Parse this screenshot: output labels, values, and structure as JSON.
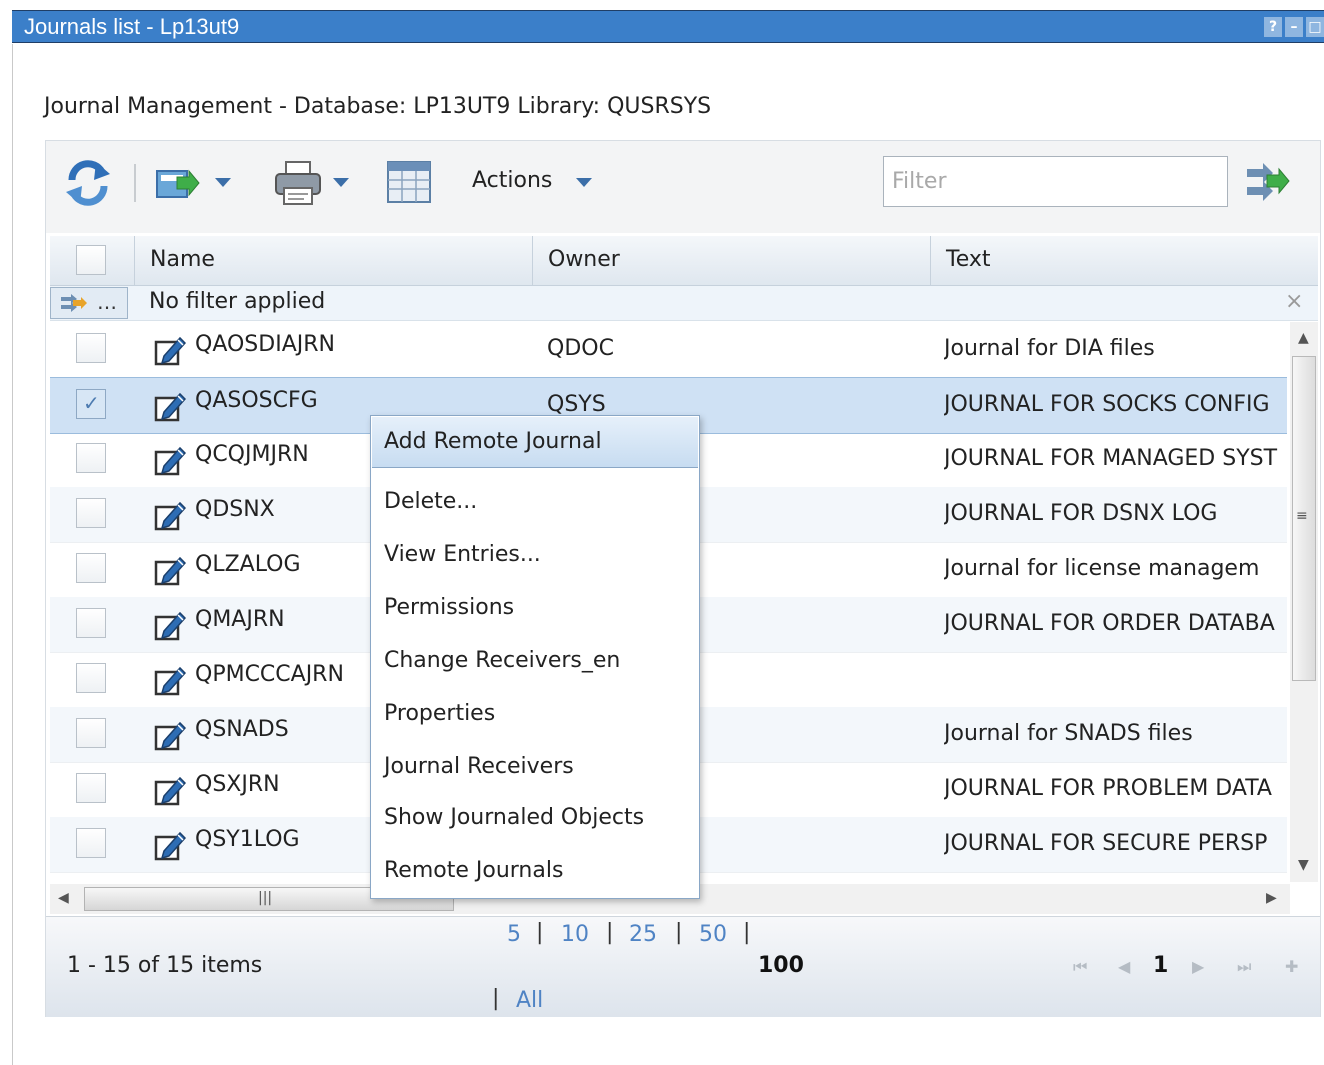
{
  "window": {
    "title": "Journals list - Lp13ut9",
    "buttons": [
      "?",
      "–",
      "□"
    ]
  },
  "heading": "Journal Management - Database: LP13UT9 Library: QUSRSYS",
  "toolbar": {
    "actions_label": "Actions",
    "filter_placeholder": "Filter",
    "icons": [
      "refresh-icon",
      "export-icon",
      "print-icon",
      "table-config-icon",
      "apply-filter-icon"
    ]
  },
  "table": {
    "columns": [
      "Name",
      "Owner",
      "Text"
    ],
    "filter_row": {
      "button": "…",
      "text": "No filter applied",
      "clear": "×"
    },
    "rows": [
      {
        "name": "QAOSDIAJRN",
        "owner": "QDOC",
        "text": "Journal for DIA files",
        "checked": false
      },
      {
        "name": "QASOSCFG",
        "owner": "QSYS",
        "text": "JOURNAL FOR SOCKS CONFIG",
        "checked": true
      },
      {
        "name": "QCQJMJRN",
        "owner": "",
        "text": "JOURNAL FOR MANAGED SYST",
        "checked": false
      },
      {
        "name": "QDSNX",
        "owner": "",
        "text": "JOURNAL FOR DSNX LOG",
        "checked": false
      },
      {
        "name": "QLZALOG",
        "owner": "",
        "text": "Journal for license managem",
        "checked": false
      },
      {
        "name": "QMAJRN",
        "owner": "",
        "text": "JOURNAL FOR ORDER DATABA",
        "checked": false
      },
      {
        "name": "QPMCCCAJRN",
        "owner": "",
        "text": "",
        "checked": false
      },
      {
        "name": "QSNADS",
        "owner": "",
        "text": "Journal for SNADS files",
        "checked": false
      },
      {
        "name": "QSXJRN",
        "owner": "",
        "text": "JOURNAL FOR PROBLEM DATA",
        "checked": false
      },
      {
        "name": "QSY1LOG",
        "owner": "",
        "text": "JOURNAL FOR SECURE PERSP",
        "checked": false
      }
    ]
  },
  "context_menu": {
    "items": [
      "Add Remote Journal",
      "Delete...",
      "View Entries...",
      "Permissions",
      "Change Receivers_en",
      "Properties",
      "Journal Receivers",
      "Show Journaled Objects",
      "Remote Journals"
    ],
    "highlighted_index": 0
  },
  "footer": {
    "count_text": "1 - 15 of 15 items",
    "page_sizes": [
      "5",
      "10",
      "25",
      "50"
    ],
    "current_page_size": "100",
    "all_label": "All",
    "separator": "|",
    "current_page": "1"
  },
  "colors": {
    "titlebar": "#3b7fc9",
    "selected_row": "#cfe1f4",
    "link": "#4f83c4",
    "menu_highlight": "#c7dcf1"
  }
}
